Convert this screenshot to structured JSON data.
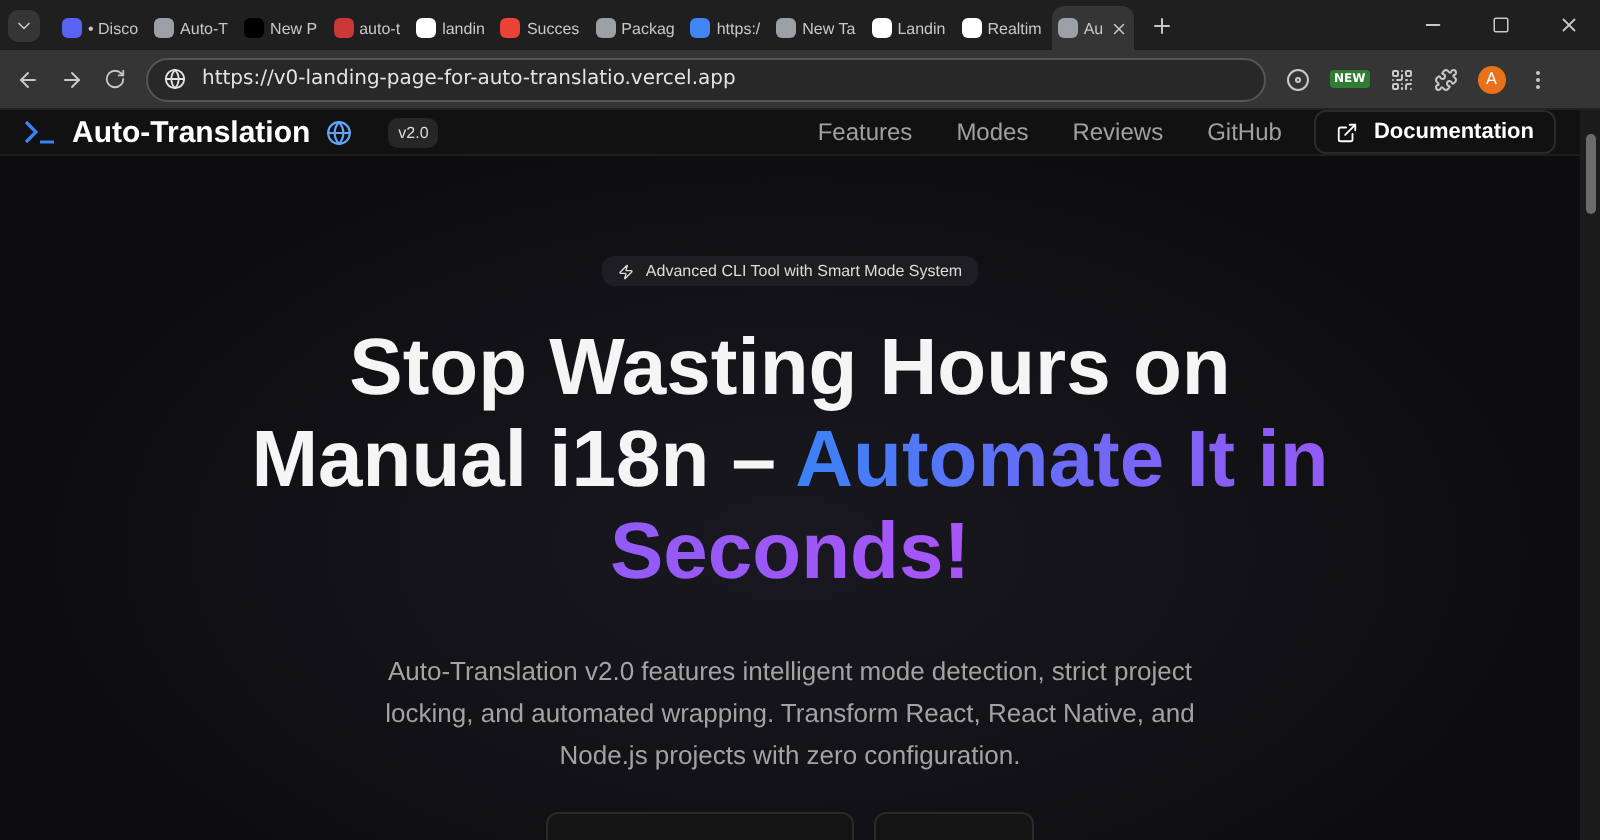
{
  "browser": {
    "tabs": [
      {
        "title": "• Disco",
        "selected": false,
        "color": "#5865f2"
      },
      {
        "title": "Auto-T",
        "selected": false,
        "color": "#9aa0a6"
      },
      {
        "title": "New P",
        "selected": false,
        "color": "#000000"
      },
      {
        "title": "auto-t",
        "selected": false,
        "color": "#cb3837"
      },
      {
        "title": "landin",
        "selected": false,
        "color": "#ffffff"
      },
      {
        "title": "Succes",
        "selected": false,
        "color": "#ea4335"
      },
      {
        "title": "Packag",
        "selected": false,
        "color": "#9aa0a6"
      },
      {
        "title": "https:/",
        "selected": false,
        "color": "#4285f4"
      },
      {
        "title": "New Ta",
        "selected": false,
        "color": "#9aa0a6"
      },
      {
        "title": "Landin",
        "selected": false,
        "color": "#ffffff"
      },
      {
        "title": "Realtim",
        "selected": false,
        "color": "#ffffff"
      },
      {
        "title": "Au",
        "selected": true,
        "color": "#9aa0a6"
      }
    ],
    "url": "https://v0-landing-page-for-auto-translatio.vercel.app",
    "extension_badge": "NEW",
    "profile_initial": "A"
  },
  "site": {
    "logo_text": "Auto-Translation",
    "version": "v2.0",
    "nav": [
      {
        "label": "Features"
      },
      {
        "label": "Modes"
      },
      {
        "label": "Reviews"
      },
      {
        "label": "GitHub"
      }
    ],
    "docs_button": "Documentation"
  },
  "hero": {
    "badge": "Advanced CLI Tool with Smart Mode System",
    "headline_plain": "Stop Wasting Hours on Manual i18n – ",
    "headline_gradient": "Automate It in Seconds!",
    "description": "Auto-Translation v2.0 features intelligent mode detection, strict project locking, and automated wrapping. Transform React, React Native, and Node.js projects with zero configuration."
  }
}
